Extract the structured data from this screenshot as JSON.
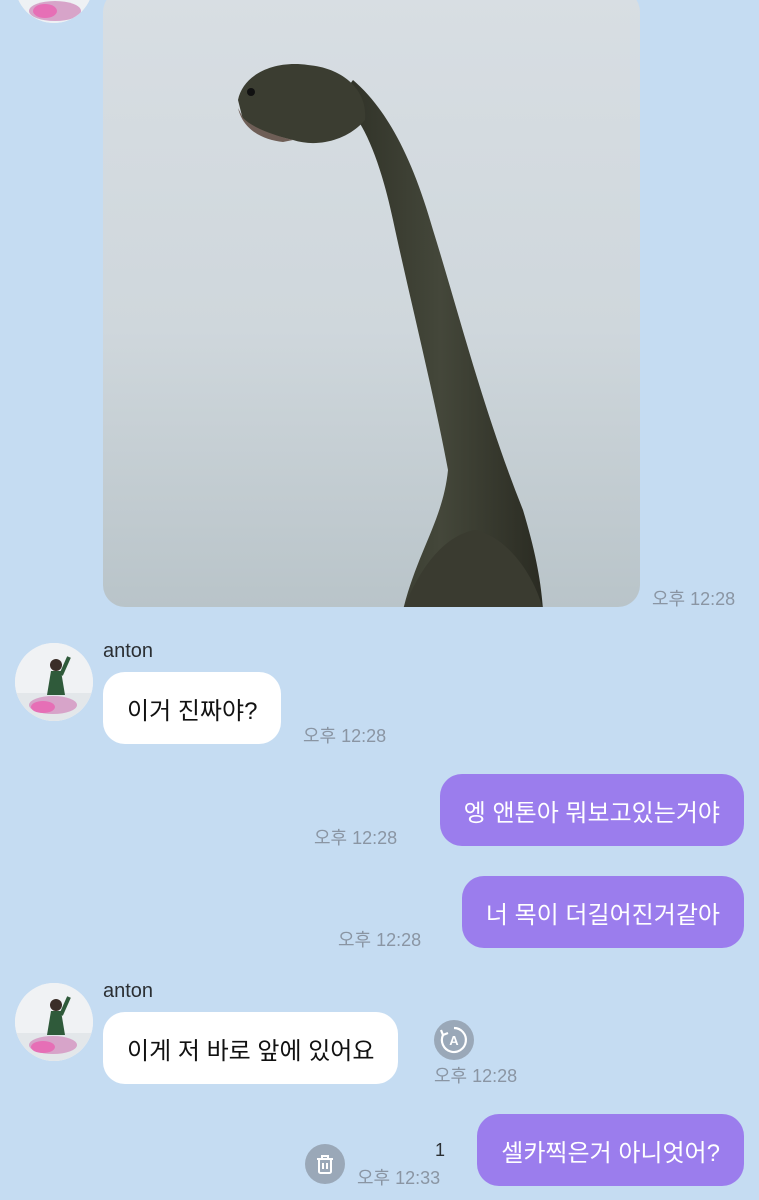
{
  "contact": {
    "name": "anton"
  },
  "messages": [
    {
      "type": "photo",
      "time": "오후 12:28"
    },
    {
      "type": "text",
      "direction": "in",
      "text": "이거 진짜야?",
      "time": "오후 12:28"
    },
    {
      "type": "text",
      "direction": "out",
      "text": "엥 앤톤아 뭐보고있는거야",
      "time": "오후 12:28"
    },
    {
      "type": "text",
      "direction": "out",
      "text": "너 목이 더길어진거같아",
      "time": "오후 12:28"
    },
    {
      "type": "text",
      "direction": "in",
      "text": "이게 저 바로 앞에 있어요",
      "time": "오후 12:28",
      "icon": "translate-icon"
    },
    {
      "type": "text",
      "direction": "out",
      "text": "셀카찍은거 아니엇어?",
      "time": "오후 12:33",
      "unread": "1",
      "icon": "trash-icon"
    }
  ],
  "colors": {
    "background": "#c5dcf2",
    "outgoing_bubble": "#9b7ded",
    "incoming_bubble": "#ffffff",
    "timestamp": "#8a95a3"
  }
}
